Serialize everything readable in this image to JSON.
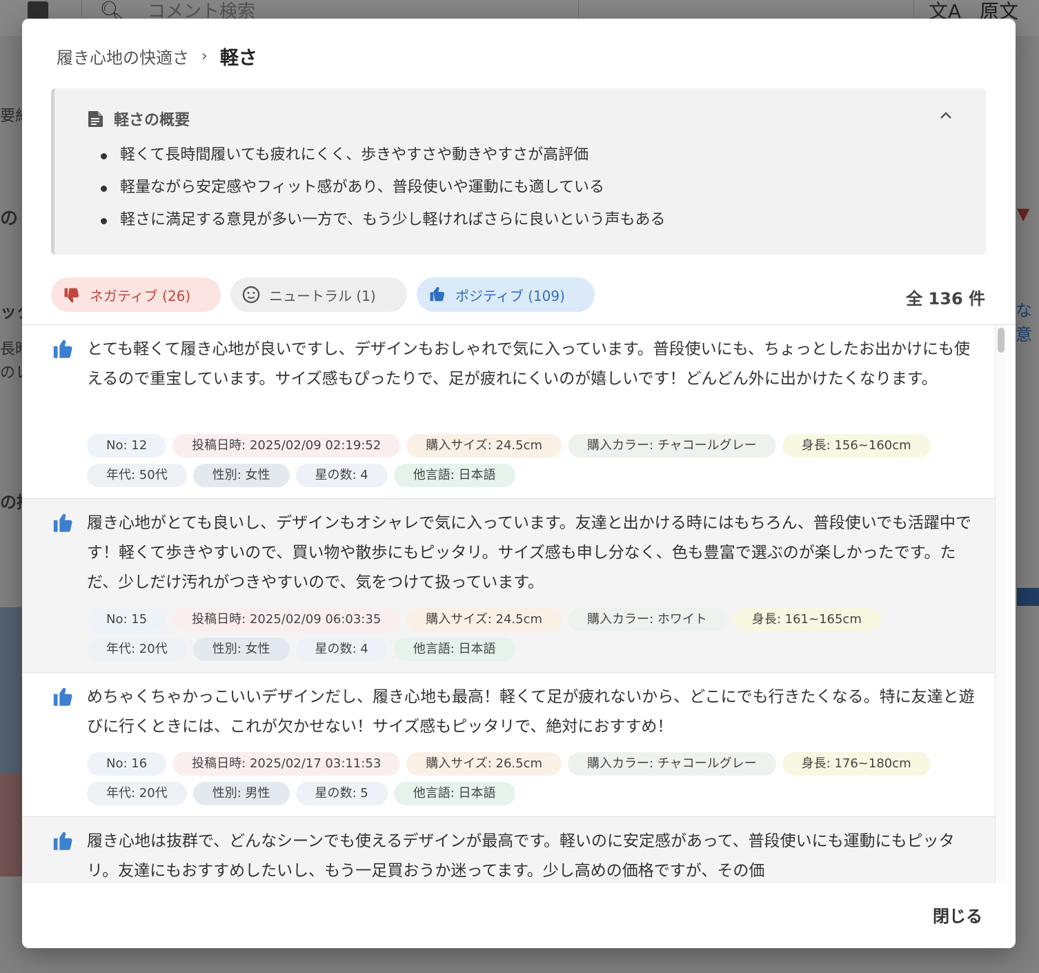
{
  "background": {
    "search_placeholder": "コメント検索",
    "original_text_label": "原文",
    "left_fragments": [
      "要約",
      "の",
      "ック",
      "長時",
      "のレ",
      "の推"
    ],
    "right_fragment": "な意"
  },
  "modal": {
    "breadcrumb": {
      "parent": "履き心地の快適さ",
      "separator": "›",
      "current": "軽さ"
    },
    "summary": {
      "title": "軽さの概要",
      "items": [
        "軽くて長時間履いても疲れにくく、歩きやすさや動きやすさが高評価",
        "軽量ながら安定感やフィット感があり、普段使いや運動にも適している",
        "軽さに満足する意見が多い一方で、もう少し軽ければさらに良いという声もある"
      ]
    },
    "filters": {
      "negative": "ネガティブ (26)",
      "neutral": "ニュートラル (1)",
      "positive": "ポジティブ (109)"
    },
    "total": "全 136 件",
    "reviews": [
      {
        "text": "とても軽くて履き心地が良いですし、デザインもおしゃれで気に入っています。普段使いにも、ちょっとしたお出かけにも使えるので重宝しています。サイズ感もぴったりで、足が疲れにくいのが嬉しいです！どんどん外に出かけたくなります。",
        "tags": {
          "no": "No: 12",
          "date": "投稿日時: 2025/02/09 02:19:52",
          "size": "購入サイズ: 24.5cm",
          "color": "購入カラー: チャコールグレー",
          "height": "身長: 156~160cm",
          "age": "年代: 50代",
          "gender": "性別: 女性",
          "stars": "星の数: 4",
          "lang": "他言語: 日本語"
        }
      },
      {
        "text": "履き心地がとても良いし、デザインもオシャレで気に入っています。友達と出かける時にはもちろん、普段使いでも活躍中です！軽くて歩きやすいので、買い物や散歩にもピッタリ。サイズ感も申し分なく、色も豊富で選ぶのが楽しかったです。ただ、少しだけ汚れがつきやすいので、気をつけて扱っています。",
        "tags": {
          "no": "No: 15",
          "date": "投稿日時: 2025/02/09 06:03:35",
          "size": "購入サイズ: 24.5cm",
          "color": "購入カラー: ホワイト",
          "height": "身長: 161~165cm",
          "age": "年代: 20代",
          "gender": "性別: 女性",
          "stars": "星の数: 4",
          "lang": "他言語: 日本語"
        }
      },
      {
        "text": "めちゃくちゃかっこいいデザインだし、履き心地も最高！軽くて足が疲れないから、どこにでも行きたくなる。特に友達と遊びに行くときには、これが欠かせない！サイズ感もピッタリで、絶対におすすめ！",
        "tags": {
          "no": "No: 16",
          "date": "投稿日時: 2025/02/17 03:11:53",
          "size": "購入サイズ: 26.5cm",
          "color": "購入カラー: チャコールグレー",
          "height": "身長: 176~180cm",
          "age": "年代: 20代",
          "gender": "性別: 男性",
          "stars": "星の数: 5",
          "lang": "他言語: 日本語"
        }
      },
      {
        "text": "履き心地は抜群で、どんなシーンでも使えるデザインが最高です。軽いのに安定感があって、普段使いにも運動にもピッタリ。友達にもおすすめしたいし、もう一足買おうか迷ってます。少し高めの価格ですが、その価"
      }
    ],
    "close_label": "閉じる"
  },
  "colors": {
    "negative": "#c0483f",
    "positive": "#2f6fbf",
    "thumb_icon": "#3d7fd1"
  },
  "icons": [
    "menu-icon",
    "search-icon",
    "translate-icon",
    "document-icon",
    "chevron-up-icon",
    "thumb-down-icon",
    "neutral-face-icon",
    "thumb-up-icon"
  ]
}
